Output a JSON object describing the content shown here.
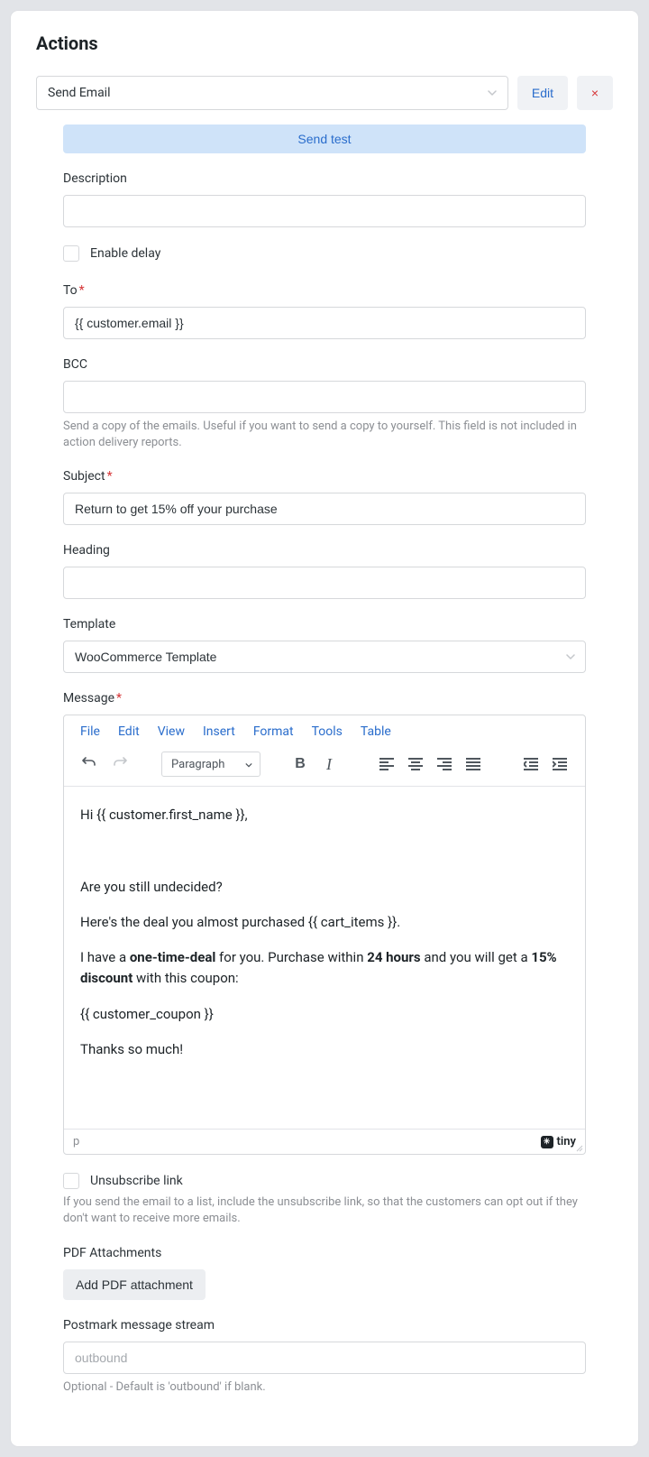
{
  "panel": {
    "title": "Actions"
  },
  "action_select": {
    "value": "Send Email"
  },
  "buttons": {
    "edit": "Edit",
    "close": "×",
    "send_test": "Send test",
    "add_pdf": "Add PDF attachment"
  },
  "labels": {
    "description": "Description",
    "enable_delay": "Enable delay",
    "to": "To",
    "bcc": "BCC",
    "subject": "Subject",
    "heading": "Heading",
    "template": "Template",
    "message": "Message",
    "unsubscribe": "Unsubscribe link",
    "pdf": "PDF Attachments",
    "postmark": "Postmark message stream"
  },
  "values": {
    "description": "",
    "to": "{{ customer.email }}",
    "bcc": "",
    "subject": "Return to get 15% off your purchase",
    "heading": "",
    "template": "WooCommerce Template",
    "postmark_placeholder": "outbound"
  },
  "help": {
    "bcc": "Send a copy of the emails. Useful if you want to send a copy to yourself. This field is not included in action delivery reports.",
    "unsubscribe": "If you send the email to a list, include the unsubscribe link, so that the customers can opt out if they don't want to receive more emails.",
    "postmark": "Optional - Default is 'outbound' if blank."
  },
  "editor": {
    "menubar": [
      "File",
      "Edit",
      "View",
      "Insert",
      "Format",
      "Tools",
      "Table"
    ],
    "format_select": "Paragraph",
    "content": {
      "line1": "Hi {{ customer.first_name }},",
      "line2": "Are you still undecided?",
      "line3": "Here's the deal you almost purchased {{ cart_items }}.",
      "line4_a": "I have a ",
      "line4_b": "one-time-deal",
      "line4_c": " for you. Purchase within ",
      "line4_d": "24 hours",
      "line4_e": " and you will get a ",
      "line4_f": "15% discount",
      "line4_g": " with this coupon:",
      "line5": "{{ customer_coupon }}",
      "line6": "Thanks so much!"
    },
    "status_path": "p",
    "branding": "tiny"
  }
}
